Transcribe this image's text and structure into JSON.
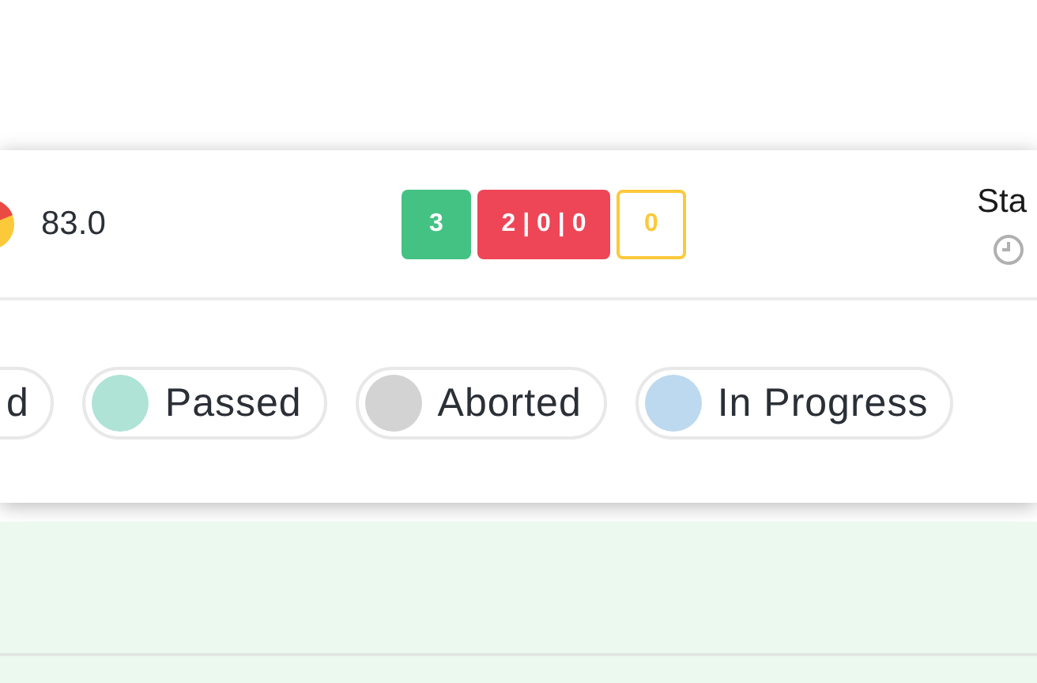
{
  "result_row": {
    "score": "83.0",
    "counts": [
      {
        "kind": "passed",
        "text": "3"
      },
      {
        "kind": "failed",
        "text": "2 | 0 | 0"
      },
      {
        "kind": "pending",
        "text": "0"
      }
    ],
    "status_heading": "Sta"
  },
  "legend": [
    {
      "label": "d"
    },
    {
      "label": "Passed",
      "color": "#aee3d6"
    },
    {
      "label": "Aborted",
      "color": "#d3d3d3"
    },
    {
      "label": "In Progress",
      "color": "#bcd9ef"
    }
  ]
}
